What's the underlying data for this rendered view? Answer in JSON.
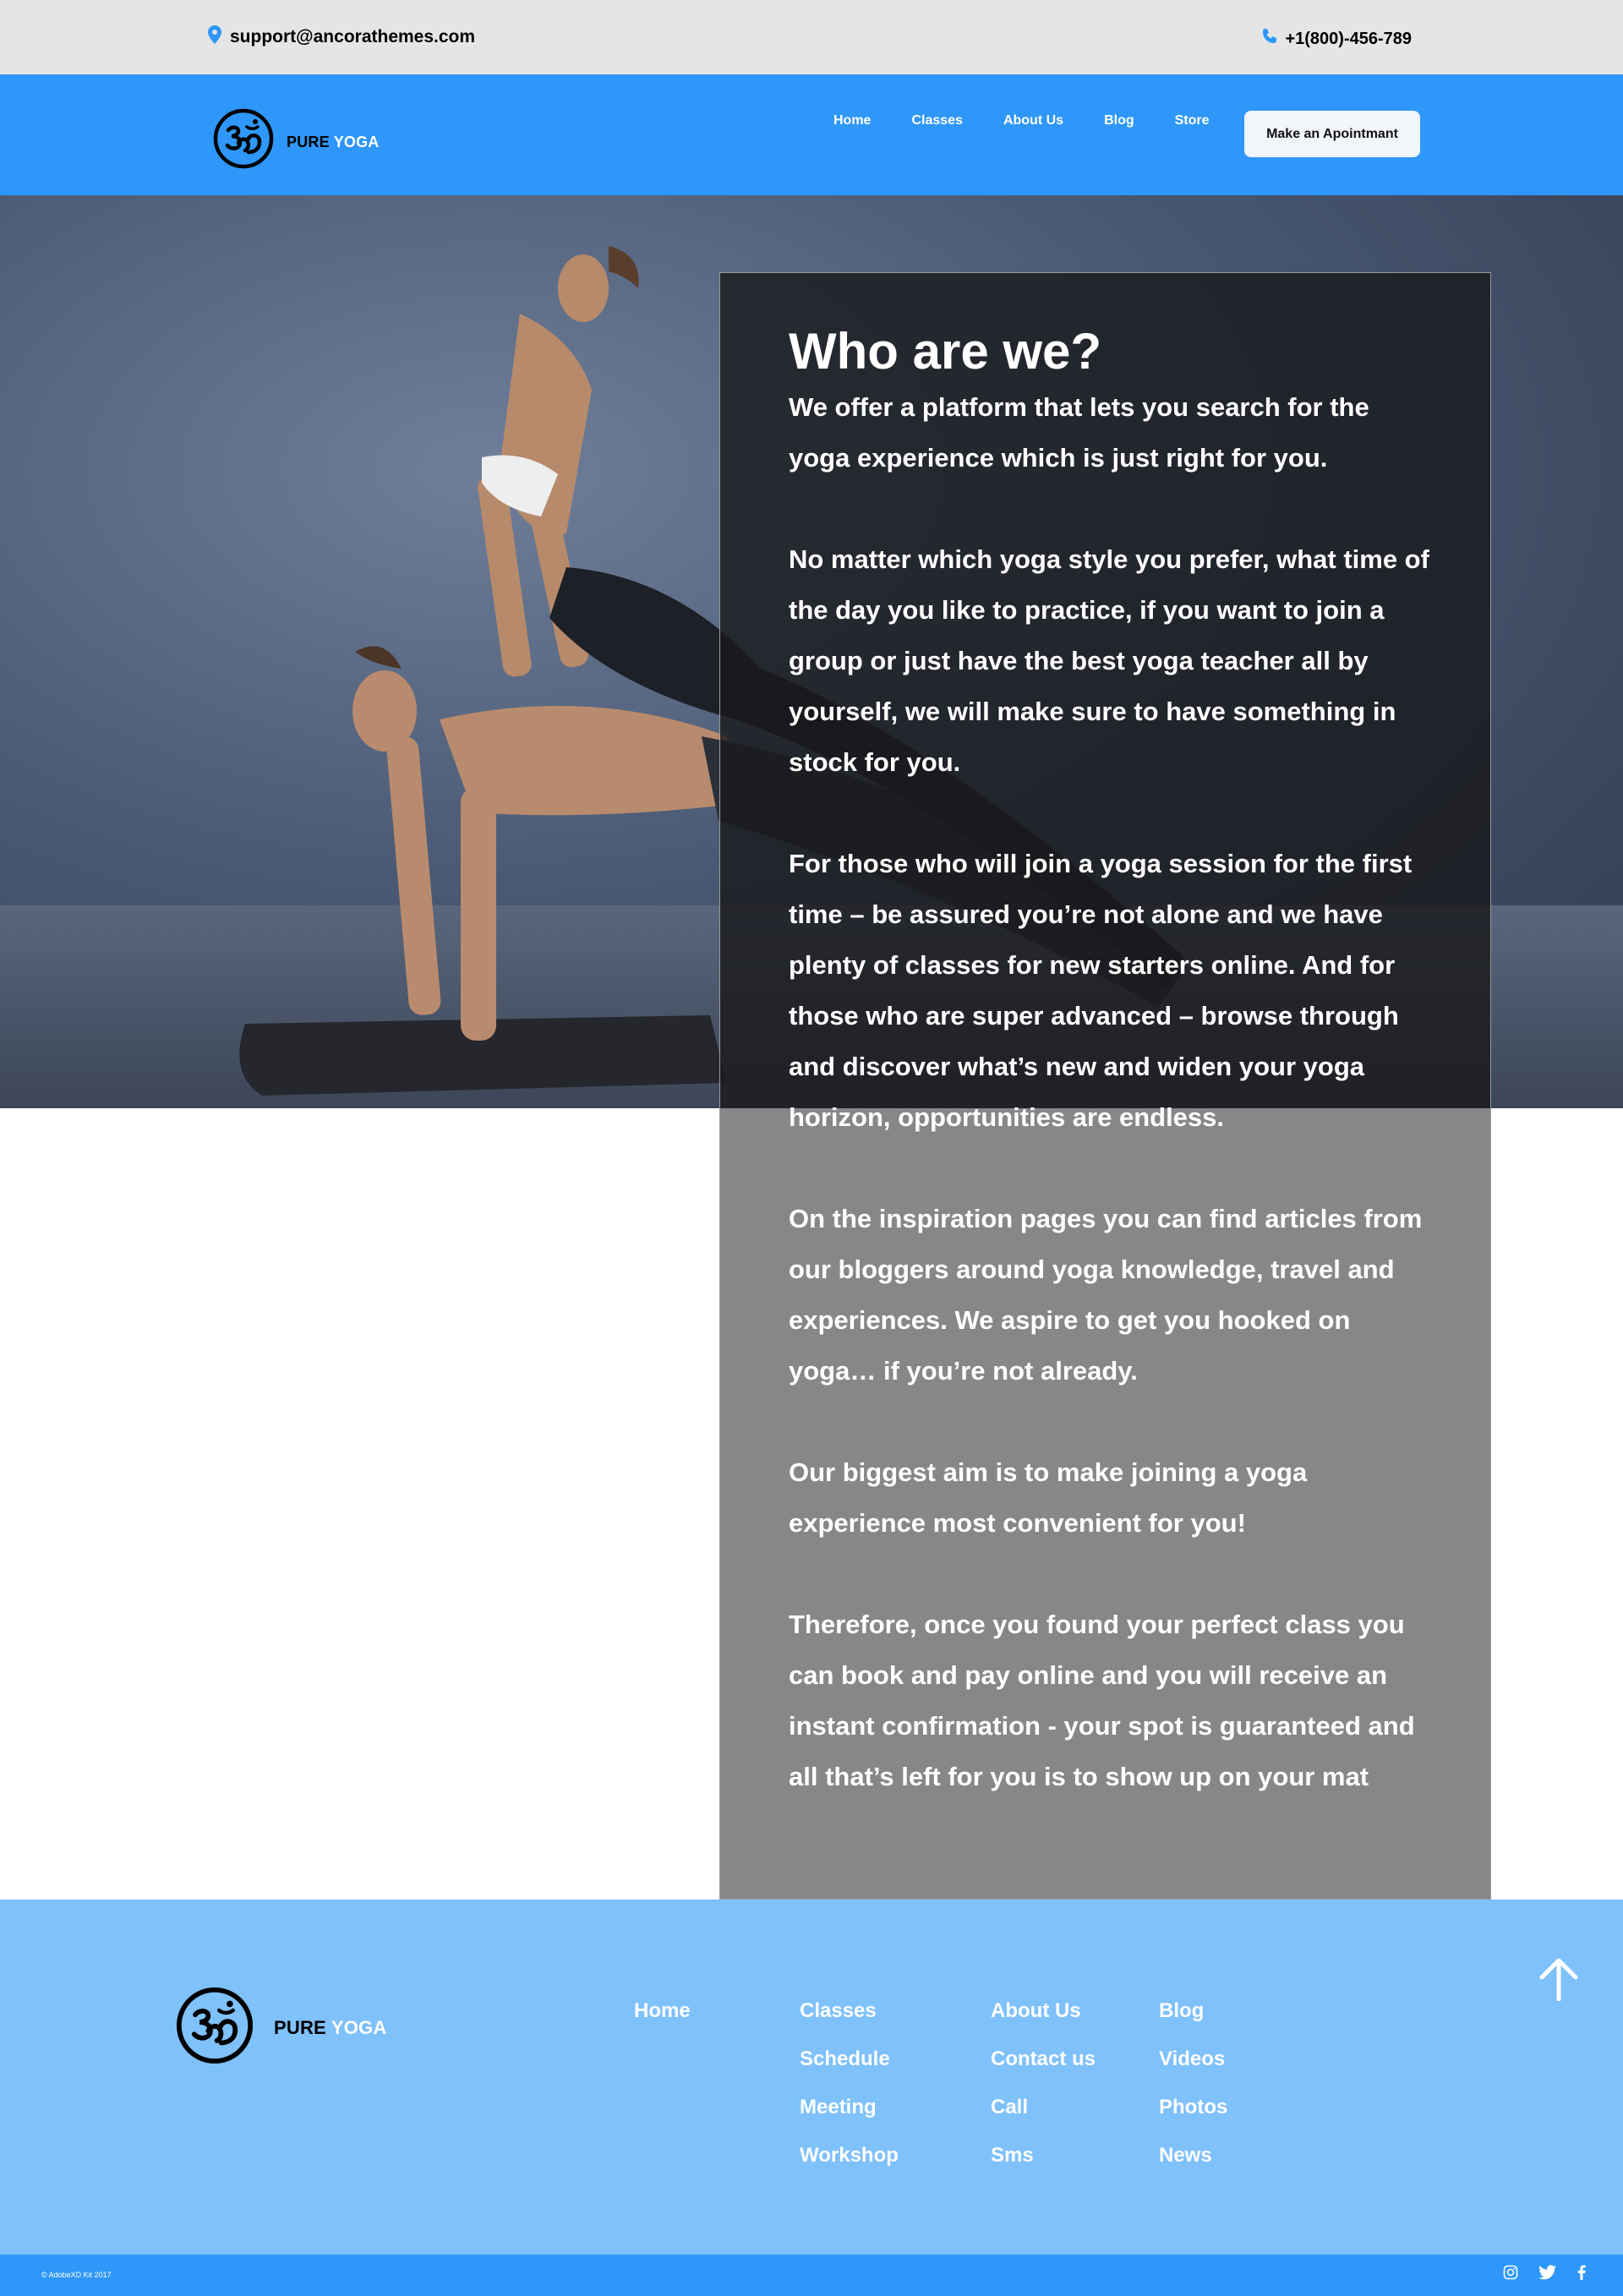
{
  "topbar": {
    "email": "support@ancorathemes.com",
    "phone": "+1(800)-456-789",
    "icons": [
      "location-pin-icon",
      "phone-icon"
    ]
  },
  "brand": {
    "word1": "PURE",
    "word2": "YOGA",
    "logo_icon": "om-symbol-icon"
  },
  "nav": {
    "items": [
      "Home",
      "Classes",
      "About Us",
      "Blog",
      "Store"
    ],
    "cta": "Make an Apointmant"
  },
  "about": {
    "heading": "Who are we?",
    "paragraphs": [
      "We offer a platform that lets you search for the yoga experience which is just right for you.",
      "No matter which yoga style you prefer, what time of the day you like to practice, if you want to join a group or just have the best yoga teacher all by yourself, we will make sure to have something in stock for you.",
      "For those who will join a yoga session for the first time – be assured you’re not alone and we have plenty of classes for new starters online. And for those who are super advanced – browse through and discover what’s new and widen your yoga horizon, opportunities are endless.",
      "On the inspiration pages you can find articles from our bloggers around yoga knowledge, travel and experiences. We aspire to get you hooked on yoga… if you’re not already.",
      "Our biggest aim is to make joining a yoga experience most convenient for you!",
      "Therefore, once you found your perfect class you can book and pay online and you will receive an instant confirmation - your spot is guaranteed and all that’s left for you is to show up on your mat"
    ]
  },
  "footer": {
    "columns": [
      [
        "Home"
      ],
      [
        "Classes",
        "Schedule",
        "Meeting",
        "Workshop"
      ],
      [
        "About Us",
        "Contact us",
        "Call",
        "Sms"
      ],
      [
        "Blog",
        "Videos",
        "Photos",
        "News"
      ]
    ],
    "to_top_icon": "arrow-up-icon",
    "copyright": "© AdobeXD Kit 2017",
    "social": [
      "instagram-icon",
      "twitter-icon",
      "facebook-icon"
    ]
  },
  "colors": {
    "topbar_bg": "#e5e5e5",
    "header_bg": "#2e97f9",
    "footer_bg": "#7fc1fb",
    "panel_dark": "#1a1a1c",
    "panel_gray": "#878787"
  }
}
